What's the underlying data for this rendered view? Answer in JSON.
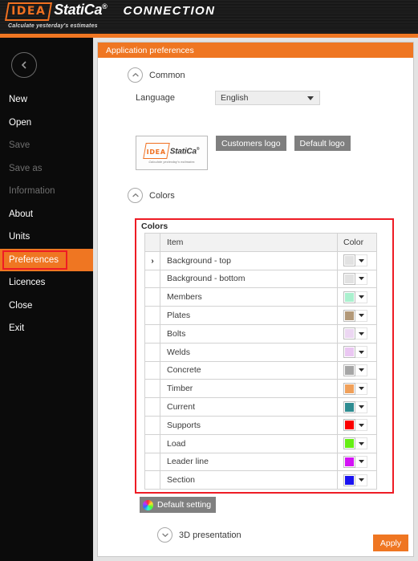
{
  "app": {
    "brand_idea": "IDEA",
    "brand_statica": "StatiCa",
    "brand_reg": "®",
    "module": "CONNECTION",
    "tagline": "Calculate yesterday's estimates"
  },
  "sidebar": {
    "collapse_icon": "chevron-left-icon",
    "items": [
      {
        "label": "New",
        "state": "enabled"
      },
      {
        "label": "Open",
        "state": "enabled"
      },
      {
        "label": "Save",
        "state": "disabled"
      },
      {
        "label": "Save as",
        "state": "disabled"
      },
      {
        "label": "Information",
        "state": "disabled"
      },
      {
        "label": "About",
        "state": "enabled"
      },
      {
        "label": "Units",
        "state": "enabled"
      },
      {
        "label": "Preferences",
        "state": "active"
      },
      {
        "label": "Licences",
        "state": "enabled"
      },
      {
        "label": "Close",
        "state": "enabled"
      },
      {
        "label": "Exit",
        "state": "enabled"
      }
    ]
  },
  "panel": {
    "header": "Application preferences",
    "common": {
      "section_title": "Common",
      "chevron": "chevron-up-icon",
      "language_label": "Language",
      "language_value": "English",
      "language_options": [
        "English"
      ]
    },
    "logo": {
      "preview_idea": "IDEA",
      "preview_statica": "StatiCa",
      "preview_reg": "®",
      "preview_tagline": "Calculate yesterday's estimates",
      "customers_logo_button": "Customers logo",
      "default_logo_button": "Default logo"
    },
    "colors": {
      "section_title": "Colors",
      "chevron": "chevron-up-icon",
      "caption": "Colors",
      "headers": {
        "arrow": "",
        "item": "Item",
        "color": "Color"
      },
      "rows": [
        {
          "selected": true,
          "arrow": "›",
          "item": "Background - top",
          "color": "#e2e2e2"
        },
        {
          "selected": false,
          "arrow": "",
          "item": "Background - bottom",
          "color": "#e2e2e2"
        },
        {
          "selected": false,
          "arrow": "",
          "item": "Members",
          "color": "#aaf0ce"
        },
        {
          "selected": false,
          "arrow": "",
          "item": "Plates",
          "color": "#b29878"
        },
        {
          "selected": false,
          "arrow": "",
          "item": "Bolts",
          "color": "#ecd7f2"
        },
        {
          "selected": false,
          "arrow": "",
          "item": "Welds",
          "color": "#eac7f2"
        },
        {
          "selected": false,
          "arrow": "",
          "item": "Concrete",
          "color": "#a6a6a6"
        },
        {
          "selected": false,
          "arrow": "",
          "item": "Timber",
          "color": "#f0a05a"
        },
        {
          "selected": false,
          "arrow": "",
          "item": "Current",
          "color": "#2e8c91"
        },
        {
          "selected": false,
          "arrow": "",
          "item": "Supports",
          "color": "#fb0000"
        },
        {
          "selected": false,
          "arrow": "",
          "item": "Load",
          "color": "#66ee15"
        },
        {
          "selected": false,
          "arrow": "",
          "item": "Leader line",
          "color": "#d313f5"
        },
        {
          "selected": false,
          "arrow": "",
          "item": "Section",
          "color": "#1a13f0"
        }
      ],
      "default_setting_button": "Default setting",
      "default_setting_icon": "color-wheel-icon"
    },
    "presentation": {
      "section_title": "3D presentation",
      "chevron": "chevron-down-icon"
    },
    "apply_button": "Apply"
  },
  "annotations": {
    "highlight_color": "#ee1c25",
    "boxes": [
      "sidebar-preferences",
      "colors-table"
    ]
  }
}
